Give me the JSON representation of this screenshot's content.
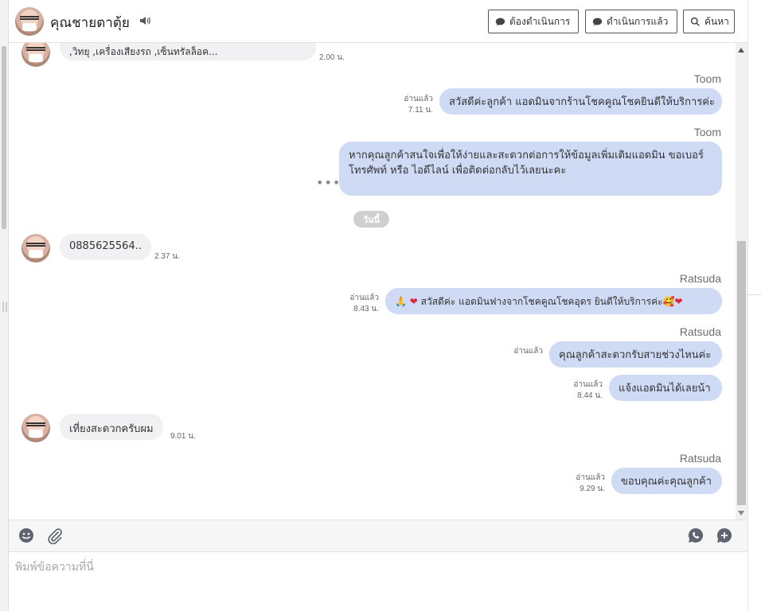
{
  "header": {
    "contact_name": "คุณชายตาตุ้ย",
    "buttons": {
      "pending": "ต้องดำเนินการ",
      "done": "ดำเนินการแล้ว",
      "search": "ค้นหา"
    }
  },
  "messages": {
    "m0": {
      "text": ",วิทยุ ,เครื่องเสียงรถ ,เซ็นทรัลล็อค...",
      "time": "2.00 น."
    },
    "m1": {
      "sender": "Toom",
      "read": "อ่านแล้ว",
      "time": "7.11 น.",
      "text": "สวัสดีค่ะลูกค้า แอดมินจากร้านโชคคูณโชคยินดีให้บริการค่ะ"
    },
    "m2": {
      "sender": "Toom",
      "text": "หากคุณลูกค้าสนใจเพื่อให้ง่ายและสะดวกต่อการให้ข้อมูลเพิ่มเติมแอดมิน ขอเบอร์โทรศัพท์ หรือ ไอดีไลน์ เพื่อติดต่อกลับไว้เลยนะคะ",
      "more": "•••"
    },
    "day_divider": "วันนี้",
    "m3": {
      "text": "0885625564..",
      "time": "2.37 น."
    },
    "m4": {
      "sender": "Ratsuda",
      "read": "อ่านแล้ว",
      "time": "8.43 น.",
      "emoji_prefix": "🙏",
      "text": "สวัสดีค่ะ แอดมินฟางจากโชคคูณโชคอุดร ยินดีให้บริการค่ะ",
      "emoji_suffix": "🥰"
    },
    "m5": {
      "sender": "Ratsuda",
      "read": "อ่านแล้ว",
      "text": "คุณลูกค้าสะดวกรับสายช่วงไหนค่ะ"
    },
    "m6": {
      "read": "อ่านแล้ว",
      "time": "8.44 น.",
      "text": "แจ้งแอดมินได้เลยน้า"
    },
    "m7": {
      "text": "เที่ยงสะดวกครับผม",
      "time": "9.01 น."
    },
    "m8": {
      "sender": "Ratsuda",
      "read": "อ่านแล้ว",
      "time": "9.29 น.",
      "text": "ขอบคุณค่ะคุณลูกค้า"
    }
  },
  "composer": {
    "placeholder": "พิมพ์ข้อความที่นี่",
    "value": ""
  },
  "icons": {
    "speaker": "speaker-icon",
    "emoji": "emoji-icon",
    "attach": "paperclip-icon",
    "call": "phone-call-icon",
    "add": "add-chat-icon"
  },
  "colors": {
    "outgoing_bubble": "#cfdaf5",
    "incoming_bubble": "#f1f1f3",
    "heart": "#e0243a"
  }
}
